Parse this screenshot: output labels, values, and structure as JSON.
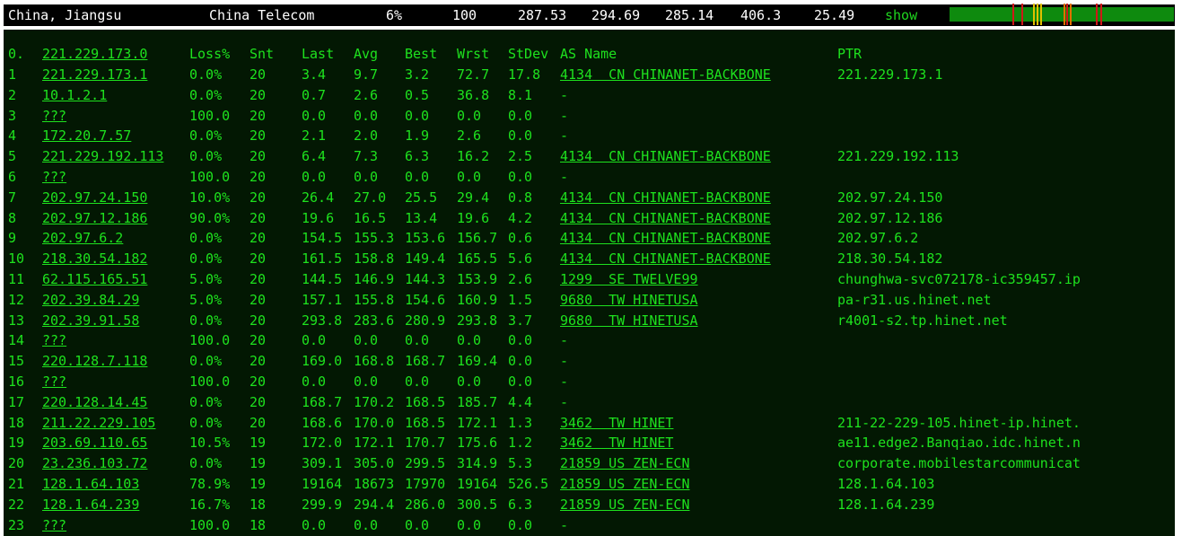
{
  "header": {
    "location": "China, Jiangsu",
    "isp": "China Telecom",
    "loss": "6%",
    "sent": "100",
    "last": "287.53",
    "avg": "294.69",
    "best": "285.14",
    "worst": "406.3",
    "stdev": "25.49",
    "show_label": "show"
  },
  "bar": {
    "base_color": "#0e8a0e",
    "mark_colors": [
      "#d01818",
      "#e0c000",
      "#e07000"
    ]
  },
  "table": {
    "columns": {
      "hop": "0.",
      "host": "221.229.173.0",
      "loss": "Loss%",
      "snt": "Snt",
      "last": "Last",
      "avg": "Avg",
      "best": "Best",
      "wrst": "Wrst",
      "stdev": "StDev",
      "as": "AS Name",
      "ptr": "PTR"
    },
    "rows": [
      {
        "hop": "1",
        "host": "221.229.173.1",
        "loss": "0.0%",
        "snt": "20",
        "last": "3.4",
        "avg": "9.7",
        "best": "3.2",
        "wrst": "72.7",
        "stdev": "17.8",
        "as": "4134  CN CHINANET-BACKBONE",
        "as_link": true,
        "ptr": "221.229.173.1"
      },
      {
        "hop": "2",
        "host": "10.1.2.1",
        "loss": "0.0%",
        "snt": "20",
        "last": "0.7",
        "avg": "2.6",
        "best": "0.5",
        "wrst": "36.8",
        "stdev": "8.1",
        "as": "-",
        "as_link": false,
        "ptr": ""
      },
      {
        "hop": "3",
        "host": "???",
        "loss": "100.0",
        "snt": "20",
        "last": "0.0",
        "avg": "0.0",
        "best": "0.0",
        "wrst": "0.0",
        "stdev": "0.0",
        "as": "-",
        "as_link": false,
        "ptr": ""
      },
      {
        "hop": "4",
        "host": "172.20.7.57",
        "loss": "0.0%",
        "snt": "20",
        "last": "2.1",
        "avg": "2.0",
        "best": "1.9",
        "wrst": "2.6",
        "stdev": "0.0",
        "as": "-",
        "as_link": false,
        "ptr": ""
      },
      {
        "hop": "5",
        "host": "221.229.192.113",
        "loss": "0.0%",
        "snt": "20",
        "last": "6.4",
        "avg": "7.3",
        "best": "6.3",
        "wrst": "16.2",
        "stdev": "2.5",
        "as": "4134  CN CHINANET-BACKBONE",
        "as_link": true,
        "ptr": "221.229.192.113"
      },
      {
        "hop": "6",
        "host": "???",
        "loss": "100.0",
        "snt": "20",
        "last": "0.0",
        "avg": "0.0",
        "best": "0.0",
        "wrst": "0.0",
        "stdev": "0.0",
        "as": "-",
        "as_link": false,
        "ptr": ""
      },
      {
        "hop": "7",
        "host": "202.97.24.150",
        "loss": "10.0%",
        "snt": "20",
        "last": "26.4",
        "avg": "27.0",
        "best": "25.5",
        "wrst": "29.4",
        "stdev": "0.8",
        "as": "4134  CN CHINANET-BACKBONE",
        "as_link": true,
        "ptr": "202.97.24.150"
      },
      {
        "hop": "8",
        "host": "202.97.12.186",
        "loss": "90.0%",
        "snt": "20",
        "last": "19.6",
        "avg": "16.5",
        "best": "13.4",
        "wrst": "19.6",
        "stdev": "4.2",
        "as": "4134  CN CHINANET-BACKBONE",
        "as_link": true,
        "ptr": "202.97.12.186"
      },
      {
        "hop": "9",
        "host": "202.97.6.2",
        "loss": "0.0%",
        "snt": "20",
        "last": "154.5",
        "avg": "155.3",
        "best": "153.6",
        "wrst": "156.7",
        "stdev": "0.6",
        "as": "4134  CN CHINANET-BACKBONE",
        "as_link": true,
        "ptr": "202.97.6.2"
      },
      {
        "hop": "10",
        "host": "218.30.54.182",
        "loss": "0.0%",
        "snt": "20",
        "last": "161.5",
        "avg": "158.8",
        "best": "149.4",
        "wrst": "165.5",
        "stdev": "5.6",
        "as": "4134  CN CHINANET-BACKBONE",
        "as_link": true,
        "ptr": "218.30.54.182"
      },
      {
        "hop": "11",
        "host": "62.115.165.51",
        "loss": "5.0%",
        "snt": "20",
        "last": "144.5",
        "avg": "146.9",
        "best": "144.3",
        "wrst": "153.9",
        "stdev": "2.6",
        "as": "1299  SE TWELVE99",
        "as_link": true,
        "ptr": "chunghwa-svc072178-ic359457.ip"
      },
      {
        "hop": "12",
        "host": "202.39.84.29",
        "loss": "5.0%",
        "snt": "20",
        "last": "157.1",
        "avg": "155.8",
        "best": "154.6",
        "wrst": "160.9",
        "stdev": "1.5",
        "as": "9680  TW HINETUSA",
        "as_link": true,
        "ptr": "pa-r31.us.hinet.net"
      },
      {
        "hop": "13",
        "host": "202.39.91.58",
        "loss": "0.0%",
        "snt": "20",
        "last": "293.8",
        "avg": "283.6",
        "best": "280.9",
        "wrst": "293.8",
        "stdev": "3.7",
        "as": "9680  TW HINETUSA",
        "as_link": true,
        "ptr": "r4001-s2.tp.hinet.net"
      },
      {
        "hop": "14",
        "host": "???",
        "loss": "100.0",
        "snt": "20",
        "last": "0.0",
        "avg": "0.0",
        "best": "0.0",
        "wrst": "0.0",
        "stdev": "0.0",
        "as": "-",
        "as_link": false,
        "ptr": ""
      },
      {
        "hop": "15",
        "host": "220.128.7.118",
        "loss": "0.0%",
        "snt": "20",
        "last": "169.0",
        "avg": "168.8",
        "best": "168.7",
        "wrst": "169.4",
        "stdev": "0.0",
        "as": "-",
        "as_link": false,
        "ptr": ""
      },
      {
        "hop": "16",
        "host": "???",
        "loss": "100.0",
        "snt": "20",
        "last": "0.0",
        "avg": "0.0",
        "best": "0.0",
        "wrst": "0.0",
        "stdev": "0.0",
        "as": "-",
        "as_link": false,
        "ptr": ""
      },
      {
        "hop": "17",
        "host": "220.128.14.45",
        "loss": "0.0%",
        "snt": "20",
        "last": "168.7",
        "avg": "170.2",
        "best": "168.5",
        "wrst": "185.7",
        "stdev": "4.4",
        "as": "-",
        "as_link": false,
        "ptr": ""
      },
      {
        "hop": "18",
        "host": "211.22.229.105",
        "loss": "0.0%",
        "snt": "20",
        "last": "168.6",
        "avg": "170.0",
        "best": "168.5",
        "wrst": "172.1",
        "stdev": "1.3",
        "as": "3462  TW HINET",
        "as_link": true,
        "ptr": "211-22-229-105.hinet-ip.hinet."
      },
      {
        "hop": "19",
        "host": "203.69.110.65",
        "loss": "10.5%",
        "snt": "19",
        "last": "172.0",
        "avg": "172.1",
        "best": "170.7",
        "wrst": "175.6",
        "stdev": "1.2",
        "as": "3462  TW HINET",
        "as_link": true,
        "ptr": "ae11.edge2.Banqiao.idc.hinet.n"
      },
      {
        "hop": "20",
        "host": "23.236.103.72",
        "loss": "0.0%",
        "snt": "19",
        "last": "309.1",
        "avg": "305.0",
        "best": "299.5",
        "wrst": "314.9",
        "stdev": "5.3",
        "as": "21859 US ZEN-ECN",
        "as_link": true,
        "ptr": "corporate.mobilestarcommunicat"
      },
      {
        "hop": "21",
        "host": "128.1.64.103",
        "loss": "78.9%",
        "snt": "19",
        "last": "19164",
        "avg": "18673",
        "best": "17970",
        "wrst": "19164",
        "stdev": "526.5",
        "as": "21859 US ZEN-ECN",
        "as_link": true,
        "ptr": "128.1.64.103"
      },
      {
        "hop": "22",
        "host": "128.1.64.239",
        "loss": "16.7%",
        "snt": "18",
        "last": "299.9",
        "avg": "294.4",
        "best": "286.0",
        "wrst": "300.5",
        "stdev": "6.3",
        "as": "21859 US ZEN-ECN",
        "as_link": true,
        "ptr": "128.1.64.239"
      },
      {
        "hop": "23",
        "host": "???",
        "loss": "100.0",
        "snt": "18",
        "last": "0.0",
        "avg": "0.0",
        "best": "0.0",
        "wrst": "0.0",
        "stdev": "0.0",
        "as": "-",
        "as_link": false,
        "ptr": ""
      }
    ]
  }
}
